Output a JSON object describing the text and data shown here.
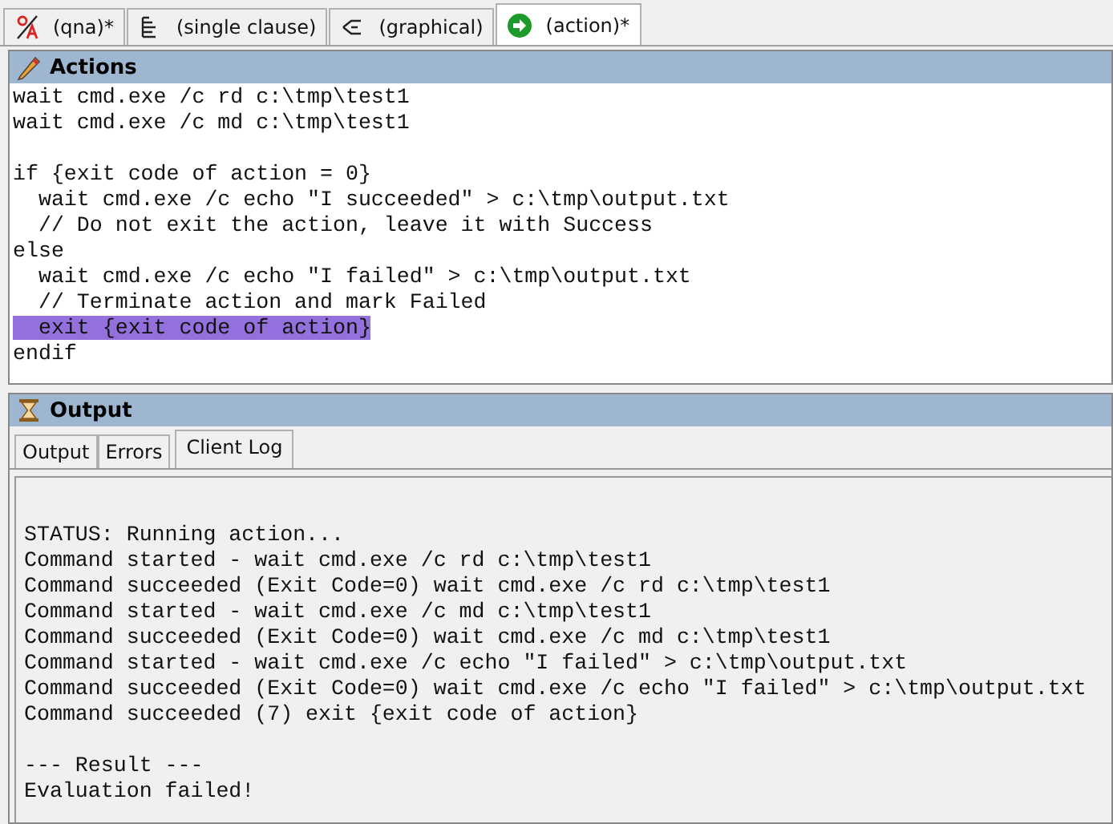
{
  "tabs": [
    {
      "label": "(qna)*",
      "kind": "qna",
      "selected": false
    },
    {
      "label": "(single clause)",
      "kind": "lines",
      "selected": false
    },
    {
      "label": "(graphical)",
      "kind": "tree",
      "selected": false
    },
    {
      "label": "(action)*",
      "kind": "go",
      "selected": true
    }
  ],
  "actions": {
    "title": "Actions",
    "lines": [
      {
        "kind": "code",
        "text": "wait cmd.exe /c rd c:\\tmp\\test1",
        "selected": false
      },
      {
        "kind": "code",
        "text": "wait cmd.exe /c md c:\\tmp\\test1",
        "selected": false
      },
      {
        "kind": "blank"
      },
      {
        "kind": "code",
        "text": "if {exit code of action = 0}",
        "selected": false
      },
      {
        "kind": "code",
        "text": "  wait cmd.exe /c echo \"I succeeded\" > c:\\tmp\\output.txt",
        "selected": false
      },
      {
        "kind": "code",
        "text": "  // Do not exit the action, leave it with Success",
        "selected": false
      },
      {
        "kind": "code",
        "text": "else",
        "selected": false
      },
      {
        "kind": "code",
        "text": "  wait cmd.exe /c echo \"I failed\" > c:\\tmp\\output.txt",
        "selected": false
      },
      {
        "kind": "code",
        "text": "  // Terminate action and mark Failed",
        "selected": false
      },
      {
        "kind": "code",
        "text": "  exit {exit code of action}",
        "selected": true
      },
      {
        "kind": "code",
        "text": "endif",
        "selected": false
      }
    ]
  },
  "output": {
    "title": "Output",
    "tabs": [
      {
        "label": "Output",
        "selected": false
      },
      {
        "label": "Errors",
        "selected": false
      },
      {
        "label": "Client Log",
        "selected": true
      }
    ],
    "lines": [
      {
        "kind": "blank"
      },
      {
        "kind": "text",
        "text": "STATUS: Running action..."
      },
      {
        "kind": "text",
        "text": "Command started - wait cmd.exe /c rd c:\\tmp\\test1"
      },
      {
        "kind": "text",
        "text": "Command succeeded (Exit Code=0) wait cmd.exe /c rd c:\\tmp\\test1"
      },
      {
        "kind": "text",
        "text": "Command started - wait cmd.exe /c md c:\\tmp\\test1"
      },
      {
        "kind": "text",
        "text": "Command succeeded (Exit Code=0) wait cmd.exe /c md c:\\tmp\\test1"
      },
      {
        "kind": "text",
        "text": "Command started - wait cmd.exe /c echo \"I failed\" > c:\\tmp\\output.txt"
      },
      {
        "kind": "text",
        "text": "Command succeeded (Exit Code=0) wait cmd.exe /c echo \"I failed\" > c:\\tmp\\output.txt"
      },
      {
        "kind": "text",
        "text": "Command succeeded (7) exit {exit code of action}"
      },
      {
        "kind": "blank"
      },
      {
        "kind": "text",
        "text": "--- Result ---"
      },
      {
        "kind": "text",
        "text": "Evaluation failed!"
      }
    ]
  }
}
